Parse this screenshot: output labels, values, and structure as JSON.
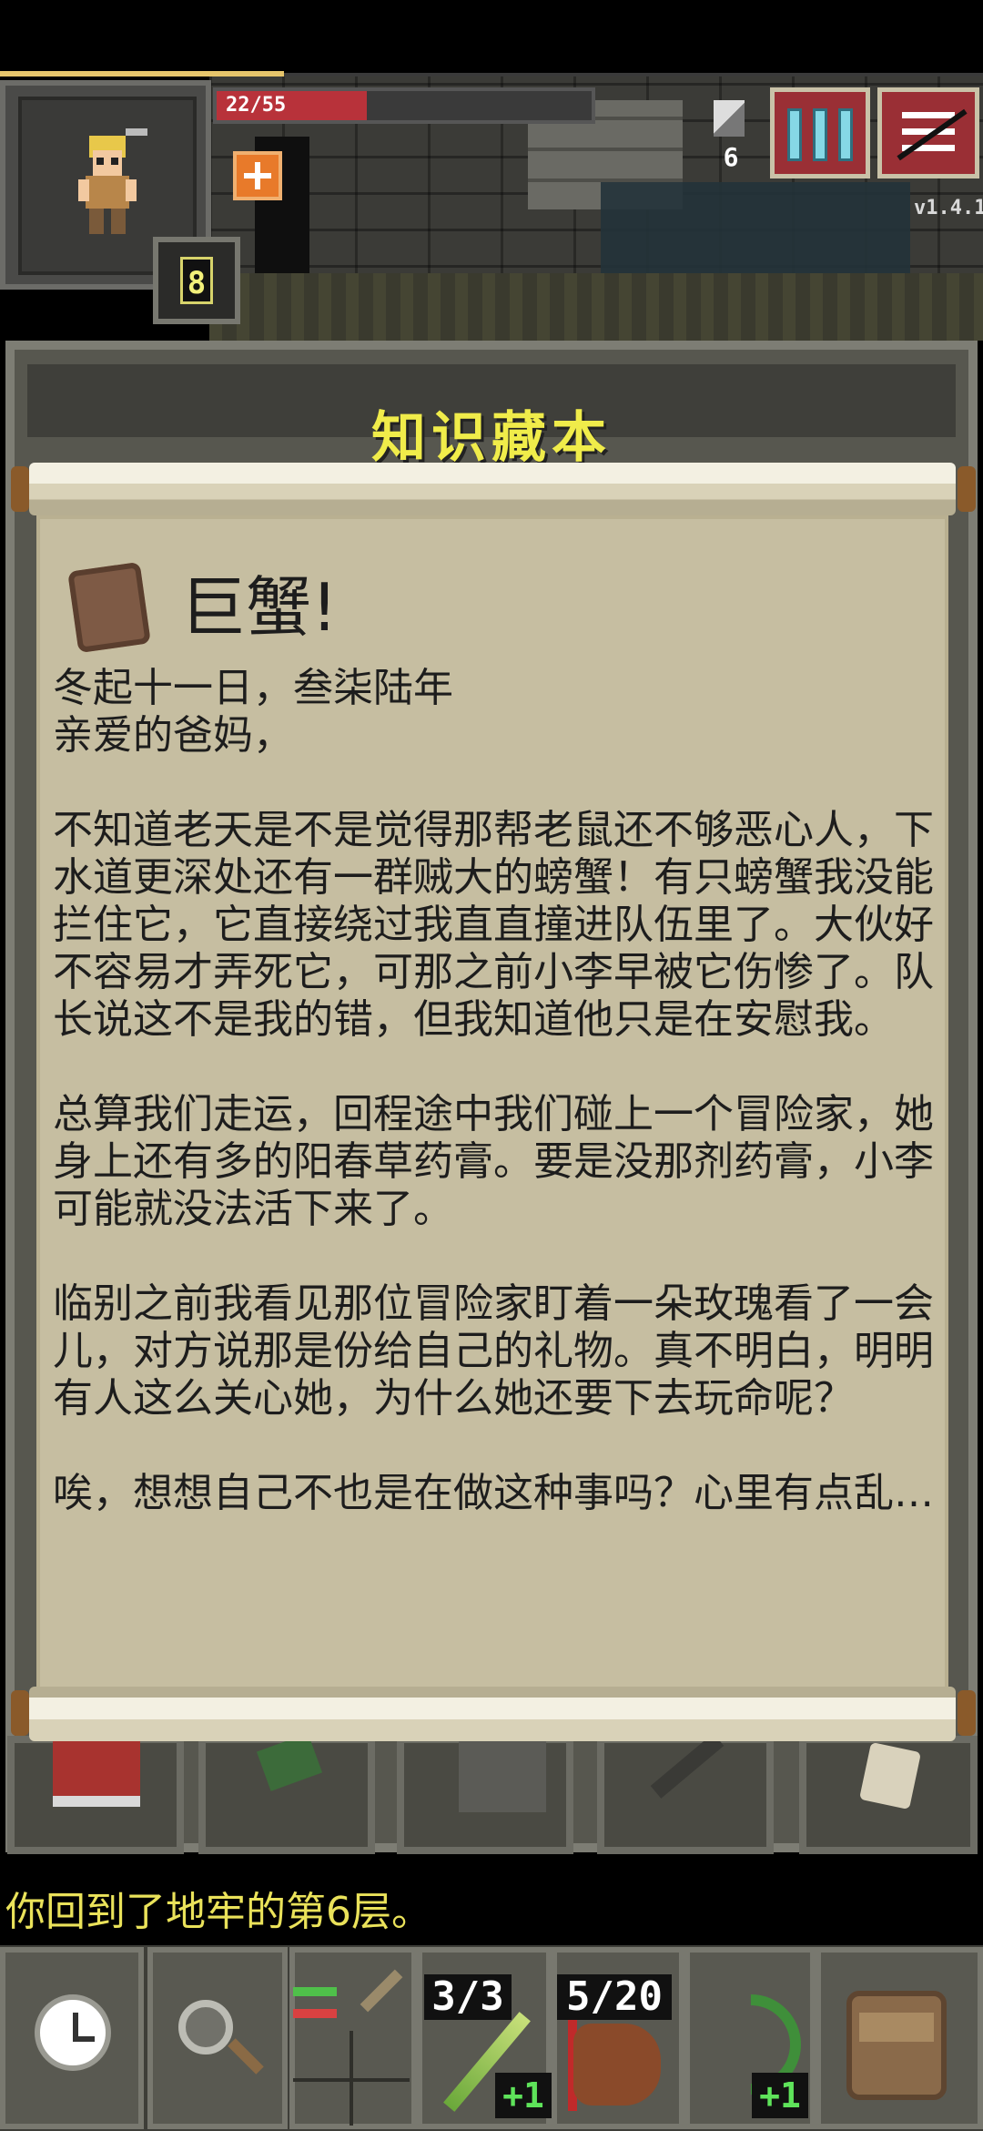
{
  "hud": {
    "hp_text": "22/55",
    "hp_fraction": 0.4,
    "hero_level": "8",
    "depth": "6",
    "version": "v1.4.1",
    "icons": {
      "journal": "journal-icon",
      "menu": "menu-icon",
      "buff": "buff-icon",
      "depth": "stairs-icon"
    }
  },
  "window": {
    "title": "知识藏本"
  },
  "note": {
    "title": "巨蟹!",
    "icon": "parchment-note-icon",
    "body": "冬起十一日，叁柒陆年\n亲爱的爸妈，\n\n不知道老天是不是觉得那帮老鼠还不够恶心人，下水道更深处还有一群贼大的螃蟹！有只螃蟹我没能拦住它，它直接绕过我直直撞进队伍里了。大伙好不容易才弄死它，可那之前小李早被它伤惨了。队长说这不是我的错，但我知道他只是在安慰我。\n\n总算我们走运，回程途中我们碰上一个冒险家，她身上还有多的阳春草药膏。要是没那剂药膏，小李可能就没法活下来了。\n\n临别之前我看见那位冒险家盯着一朵玫瑰看了一会儿，对方说那是份给自己的礼物。真不明白，明明有人这么关心她，为什么她还要下去玩命呢？\n\n唉，想想自己不也是在做这种事吗？心里有点乱…"
  },
  "log": {
    "message": "你回到了地牢的第6层。"
  },
  "toolbar": {
    "wand_charges": "3/3",
    "wand_upgrade": "+1",
    "waterskin_charges": "5/20",
    "bow_upgrade": "+1"
  },
  "colors": {
    "accent_title": "#f0ec4a",
    "log_text": "#eae25a",
    "hp_bar": "#b8323a",
    "scroll_paper": "#c6bea1"
  }
}
